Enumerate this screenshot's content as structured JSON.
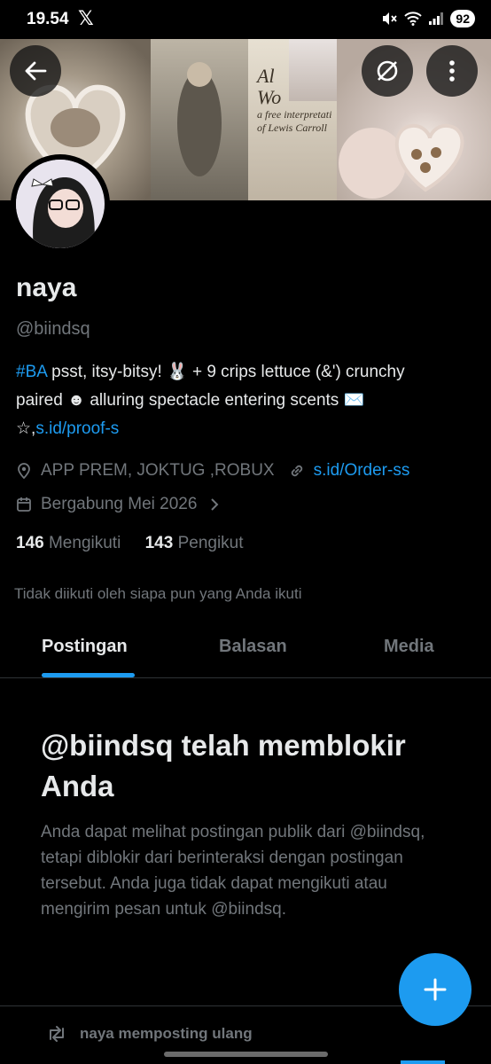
{
  "status_bar": {
    "time": "19.54",
    "x_logo": "𝕏",
    "battery": "92"
  },
  "banner": {
    "book_lines": [
      "Al",
      "Wo",
      "a free interpretati",
      "of Lewis Carroll"
    ]
  },
  "profile": {
    "name": "naya",
    "handle": "@biindsq",
    "bio_hashtag": "#BA",
    "bio_line1_rest": " psst, itsy-bitsy! 🐰 + 9 crips lettuce (&') crunchy",
    "bio_line2": "paired ☻ alluring spectacle entering scents ✉️",
    "bio_line3_prefix": "☆,",
    "bio_link": "s.id/proof-s",
    "location": "APP PREM, JOKTUG ,ROBUX",
    "website": "s.id/Order-ss",
    "joined": "Bergabung Mei 2026",
    "following_count": "146",
    "following_label": "Mengikuti",
    "followers_count": "143",
    "followers_label": "Pengikut",
    "followed_note": "Tidak diikuti oleh siapa pun yang Anda ikuti"
  },
  "tabs": [
    {
      "label": "Postingan",
      "active": true
    },
    {
      "label": "Balasan",
      "active": false
    },
    {
      "label": "Media",
      "active": false
    }
  ],
  "blocked": {
    "title": "@biindsq telah memblokir Anda",
    "body": "Anda dapat melihat postingan publik dari @biindsq, tetapi diblokir dari berinteraksi dengan postingan tersebut. Anda juga tidak dapat mengikuti atau mengirim pesan untuk @biindsq."
  },
  "repost": {
    "label": "naya memposting ulang"
  },
  "colors": {
    "accent": "#1d9bf0",
    "text": "#e7e9ea",
    "muted": "#71767b",
    "background": "#000000"
  },
  "icons": [
    "back-arrow-icon",
    "translate-icon",
    "more-icon",
    "location-icon",
    "link-icon",
    "calendar-icon",
    "chevron-right-icon",
    "plus-icon",
    "repost-icon"
  ]
}
